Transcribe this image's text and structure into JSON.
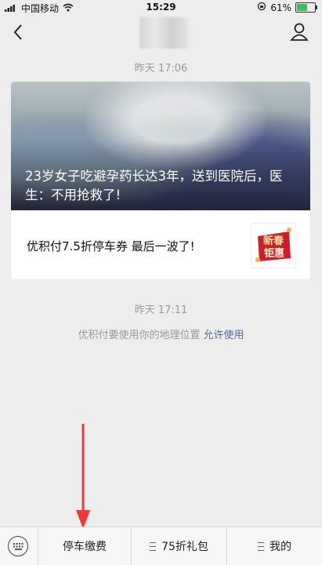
{
  "status_bar": {
    "carrier": "中国移动",
    "time": "15:29",
    "battery": "61%",
    "battery_level": 0.61
  },
  "chat": {
    "timestamp_1": "昨天 17:06",
    "article": {
      "headline": "23岁女子吃避孕药长达3年，送到医院后，医生：不用抢救了!",
      "promo_text": "优积付7.5折停车券 最后一波了!",
      "thumb_text_1": "新春",
      "thumb_text_2": "钜惠"
    },
    "timestamp_2": "昨天 17:11",
    "location_notice": "优积付要使用你的地理位置",
    "location_allow": "允许使用"
  },
  "menu": {
    "items": [
      {
        "label": "停车缴费"
      },
      {
        "label": "75折礼包"
      },
      {
        "label": "我的"
      }
    ]
  },
  "colors": {
    "link": "#576b95",
    "annotation_arrow": "#f03a3a",
    "background": "#ededed"
  }
}
